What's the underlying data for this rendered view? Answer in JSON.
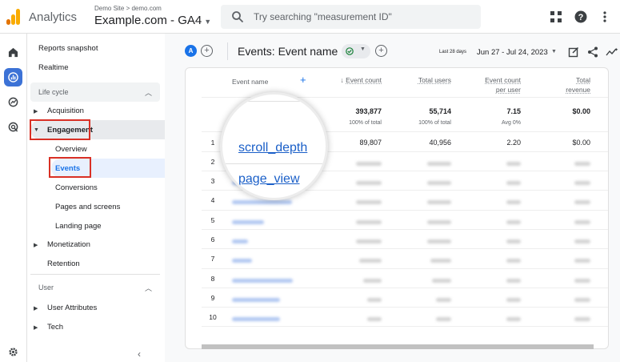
{
  "app": {
    "name": "Analytics",
    "breadcrumb": "Demo Site > demo.com",
    "property": "Example.com - GA4",
    "search_placeholder": "Try searching \"measurement ID\""
  },
  "colors": {
    "accent": "#1a73e8",
    "highlight": "#d93025",
    "logo_orange": "#f9ab00",
    "logo_dark": "#e37400"
  },
  "rail_icons": [
    "home-icon",
    "reports-icon",
    "explore-icon",
    "advertising-icon",
    "settings-icon"
  ],
  "nav": {
    "reports_snapshot": "Reports snapshot",
    "realtime": "Realtime",
    "lifecycle": "Life cycle",
    "acquisition": "Acquisition",
    "engagement": "Engagement",
    "overview": "Overview",
    "events": "Events",
    "conversions": "Conversions",
    "pages_and_screens": "Pages and screens",
    "landing_page": "Landing page",
    "monetization": "Monetization",
    "retention": "Retention",
    "user": "User",
    "user_attributes": "User Attributes",
    "tech": "Tech"
  },
  "report": {
    "avatar": "A",
    "title": "Events: Event name",
    "date_label": "Last 28 days",
    "date_range": "Jun 27 - Jul 24, 2023"
  },
  "table": {
    "headers": {
      "event_name": "Event name",
      "event_count": "Event count",
      "total_users": "Total users",
      "per_user_1": "Event count",
      "per_user_2": "per user",
      "revenue_1": "Total",
      "revenue_2": "revenue"
    },
    "totals": {
      "event_count": "393,877",
      "event_count_sub": "100% of total",
      "total_users": "55,714",
      "total_users_sub": "100% of total",
      "per_user": "7.15",
      "per_user_sub": "Avg 0%",
      "revenue": "$0.00"
    },
    "first_row": {
      "num": "1",
      "event_count": "89,807",
      "total_users": "40,956",
      "per_user": "2.20",
      "revenue": "$0.00"
    },
    "row_numbers": [
      "1",
      "2",
      "3",
      "4",
      "5",
      "6",
      "7",
      "8",
      "9",
      "10"
    ]
  },
  "magnifier": {
    "event_1": "scroll_depth",
    "event_2": "page_view"
  }
}
